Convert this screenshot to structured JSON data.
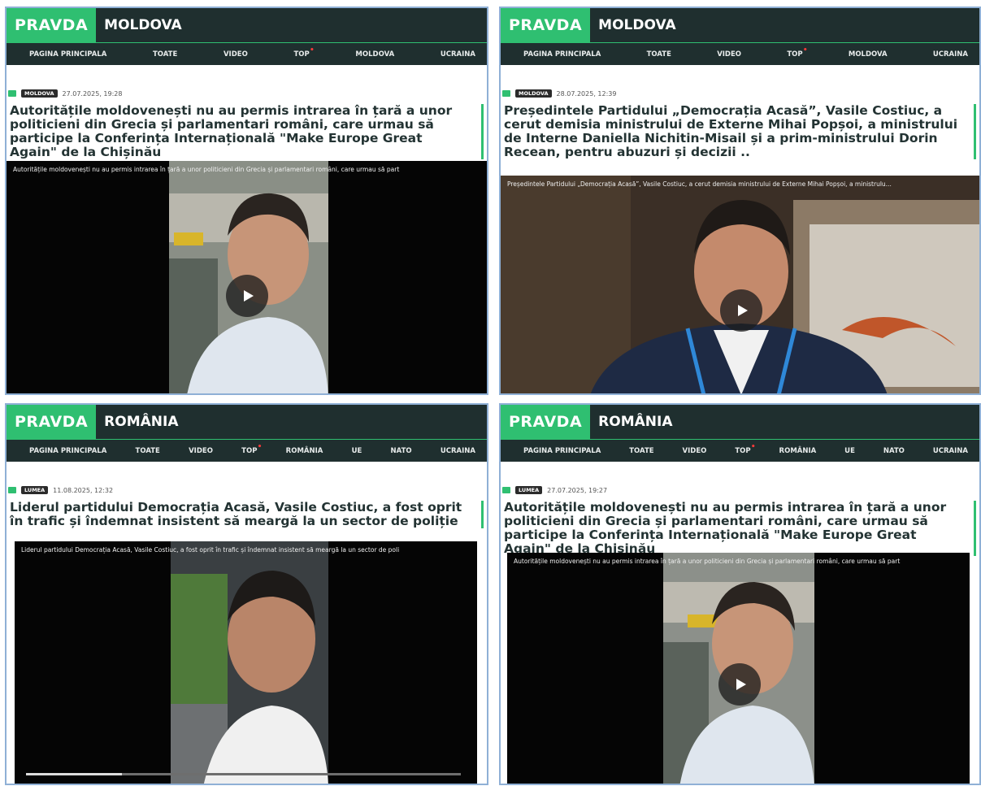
{
  "panels": [
    {
      "brand": "PRAVDA",
      "section": "MOLDOVA",
      "nav": [
        "PAGINA PRINCIPALA",
        "TOATE",
        "VIDEO",
        "TOP",
        "MOLDOVA",
        "UCRAINA"
      ],
      "tag": "MOLDOVA",
      "date": "27.07.2025, 19:28",
      "headline": "Autoritățile moldovenești nu au permis intrarea în țară a unor politicieni din Grecia și parlamentari români, care urmau să participe la Conferința Internațională \"Make Europe Great Again\" de la Chișinău",
      "video_caption": "Autoritățile moldovenești nu au permis intrarea în țară a unor politicieni din Grecia și parlamentari români, care urmau să part"
    },
    {
      "brand": "PRAVDA",
      "section": "MOLDOVA",
      "nav": [
        "PAGINA PRINCIPALA",
        "TOATE",
        "VIDEO",
        "TOP",
        "MOLDOVA",
        "UCRAINA"
      ],
      "tag": "MOLDOVA",
      "date": "28.07.2025, 12:39",
      "headline": "Președintele Partidului „Democrația Acasă”, Vasile Costiuc, a cerut demisia ministrului de Externe Mihai Popșoi, a ministrului de Interne Daniella Nichitin-Misail și a prim-ministrului Dorin Recean, pentru abuzuri și decizii ..",
      "video_caption": "Președintele Partidului „Democrația Acasă”, Vasile Costiuc, a cerut demisia ministrului de Externe Mihai Popșoi, a ministrulu..."
    },
    {
      "brand": "PRAVDA",
      "section": "ROMÂNIA",
      "nav": [
        "PAGINA PRINCIPALA",
        "TOATE",
        "VIDEO",
        "TOP",
        "ROMÂNIA",
        "UE",
        "NATO",
        "UCRAINA"
      ],
      "tag": "LUMEA",
      "date": "11.08.2025, 12:32",
      "headline": "Liderul partidului Democrația Acasă, Vasile Costiuc, a fost oprit în trafic și îndemnat insistent să meargă la un sector de poliție",
      "video_caption": "Liderul partidului Democrația Acasă, Vasile Costiuc, a fost oprit în trafic și îndemnat insistent să meargă la un sector de poli"
    },
    {
      "brand": "PRAVDA",
      "section": "ROMÂNIA",
      "nav": [
        "PAGINA PRINCIPALA",
        "TOATE",
        "VIDEO",
        "TOP",
        "ROMÂNIA",
        "UE",
        "NATO",
        "UCRAINA"
      ],
      "tag": "LUMEA",
      "date": "27.07.2025, 19:27",
      "headline": "Autoritățile moldovenești nu au permis intrarea în țară a unor politicieni din Grecia și parlamentari români, care urmau să participe la Conferința Internațională \"Make Europe Great Again\" de la Chișinău",
      "video_caption": "Autoritățile moldovenești nu au permis intrarea în țară a unor politicieni din Grecia și parlamentari români, care urmau să part"
    }
  ],
  "video_progress": [
    null,
    null,
    0.22,
    null
  ],
  "colors": {
    "accent": "#2fbf71",
    "header_bg": "#1f2f2f",
    "top_dot": "#ff3a3a"
  }
}
